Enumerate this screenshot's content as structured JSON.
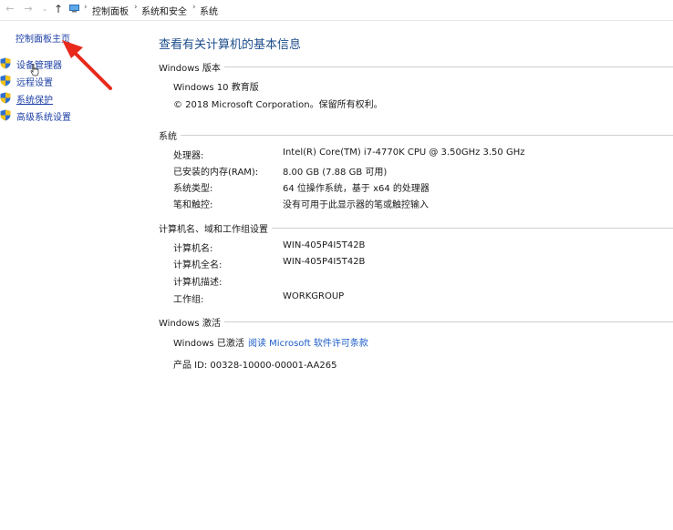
{
  "breadcrumb": {
    "items": [
      "控制面板",
      "系统和安全",
      "系统"
    ],
    "separator": "›"
  },
  "nav": {
    "back_icon": "←",
    "forward_icon": "→",
    "recent_icon": "⌄",
    "up_icon": "↑"
  },
  "sidebar": {
    "home": "控制面板主页",
    "items": [
      {
        "label": "设备管理器"
      },
      {
        "label": "远程设置"
      },
      {
        "label": "系统保护"
      },
      {
        "label": "高级系统设置"
      }
    ]
  },
  "main": {
    "title": "查看有关计算机的基本信息",
    "windows_edition": {
      "heading": "Windows 版本",
      "edition": "Windows 10 教育版",
      "copyright": "© 2018 Microsoft Corporation。保留所有权利。"
    },
    "system": {
      "heading": "系统",
      "rows": [
        {
          "label": "处理器:",
          "value": "Intel(R) Core(TM) i7-4770K CPU @ 3.50GHz   3.50 GHz"
        },
        {
          "label": "已安装的内存(RAM):",
          "value": "8.00 GB (7.88 GB 可用)"
        },
        {
          "label": "系统类型:",
          "value": "64 位操作系统，基于 x64 的处理器"
        },
        {
          "label": "笔和触控:",
          "value": "没有可用于此显示器的笔或触控输入"
        }
      ]
    },
    "computer": {
      "heading": "计算机名、域和工作组设置",
      "rows": [
        {
          "label": "计算机名:",
          "value": "WIN-405P4I5T42B"
        },
        {
          "label": "计算机全名:",
          "value": "WIN-405P4I5T42B"
        },
        {
          "label": "计算机描述:",
          "value": ""
        },
        {
          "label": "工作组:",
          "value": "WORKGROUP"
        }
      ]
    },
    "activation": {
      "heading": "Windows 激活",
      "status": "Windows 已激活",
      "license_link": "阅读 Microsoft 软件许可条款",
      "product_id": "产品 ID: 00328-10000-00001-AA265"
    }
  },
  "colors": {
    "link": "#1c3fa5",
    "title": "#1e4e8c",
    "annotation_arrow": "#e8291c"
  }
}
